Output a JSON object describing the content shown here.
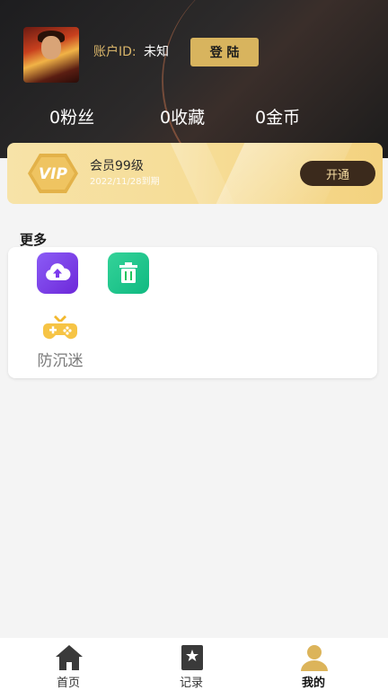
{
  "header": {
    "account_label": "账户ID:",
    "account_value": "未知",
    "login_label": "登 陆"
  },
  "stats": [
    {
      "label": "0粉丝"
    },
    {
      "label": "0收藏"
    },
    {
      "label": "0金币"
    }
  ],
  "vip": {
    "badge": "VIP",
    "title": "会员99级",
    "expiry": "2022/11/28到期",
    "open_label": "开通"
  },
  "more": {
    "title": "更多",
    "items": [
      {
        "icon": "cloud-upload-icon"
      },
      {
        "icon": "trash-icon"
      },
      {
        "icon": "gamepad-icon",
        "label": "防沉迷"
      }
    ]
  },
  "tabbar": [
    {
      "label": "首页",
      "icon": "home-icon"
    },
    {
      "label": "记录",
      "icon": "bookmark-icon"
    },
    {
      "label": "我的",
      "icon": "user-icon",
      "active": true
    }
  ],
  "colors": {
    "accent_gold": "#d8b45e",
    "header_dark": "#1d1d1f",
    "vip_gold": "#f6dc95",
    "upload_purple": "#7c3aed",
    "trash_green": "#22c55e"
  }
}
